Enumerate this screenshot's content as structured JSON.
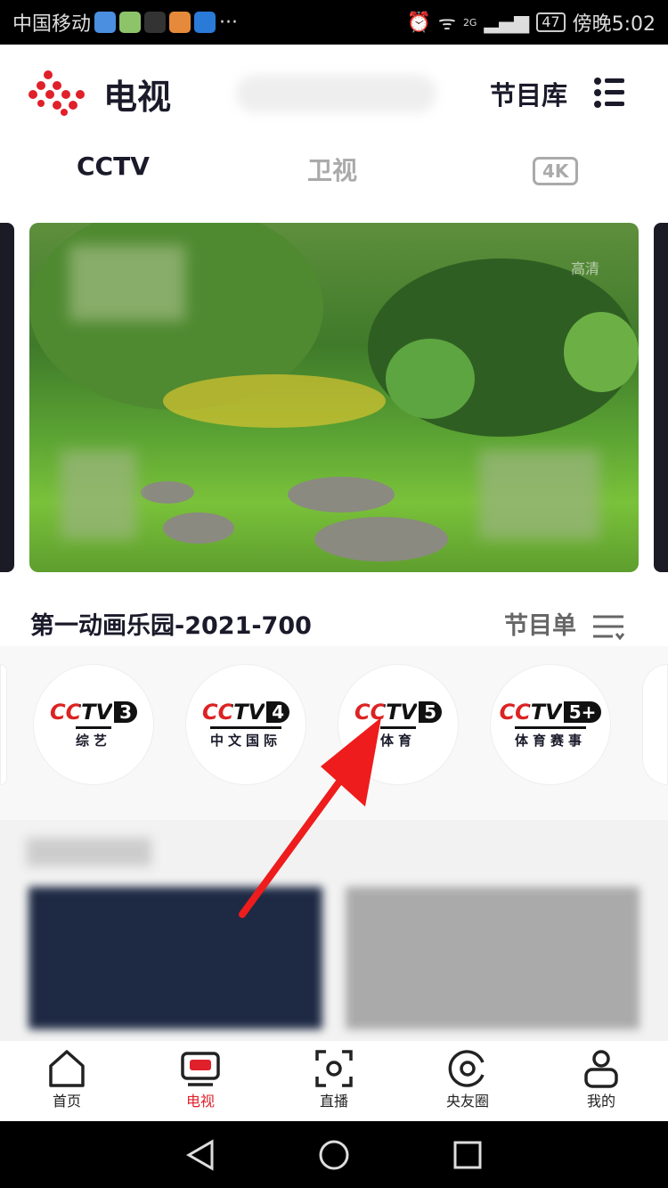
{
  "status_bar": {
    "carrier": "中国移动",
    "more": "···",
    "network": "2G",
    "battery": "47",
    "time": "傍晚5:02"
  },
  "header": {
    "title": "电视",
    "library_label": "节目库"
  },
  "tabs": [
    {
      "label": "CCTV",
      "active": true
    },
    {
      "label": "卫视"
    },
    {
      "label": "4K"
    }
  ],
  "player": {
    "quality": "高清"
  },
  "program": {
    "title": "第一动画乐园-2021-700",
    "schedule_label": "节目单"
  },
  "channels": [
    {
      "logo": "CCTV",
      "number": "3",
      "name": "综艺"
    },
    {
      "logo": "CCTV",
      "number": "4",
      "name": "中文国际"
    },
    {
      "logo": "CCTV",
      "number": "5",
      "name": "体育"
    },
    {
      "logo": "CCTV",
      "number": "5+",
      "name": "体育赛事"
    }
  ],
  "bottom_nav": [
    {
      "label": "首页",
      "icon": "home-icon"
    },
    {
      "label": "电视",
      "icon": "tv-icon",
      "active": true
    },
    {
      "label": "直播",
      "icon": "live-icon"
    },
    {
      "label": "央友圈",
      "icon": "circle-icon"
    },
    {
      "label": "我的",
      "icon": "user-icon"
    }
  ],
  "colors": {
    "accent": "#e0202a",
    "annotation_arrow": "#ee1c1c"
  }
}
